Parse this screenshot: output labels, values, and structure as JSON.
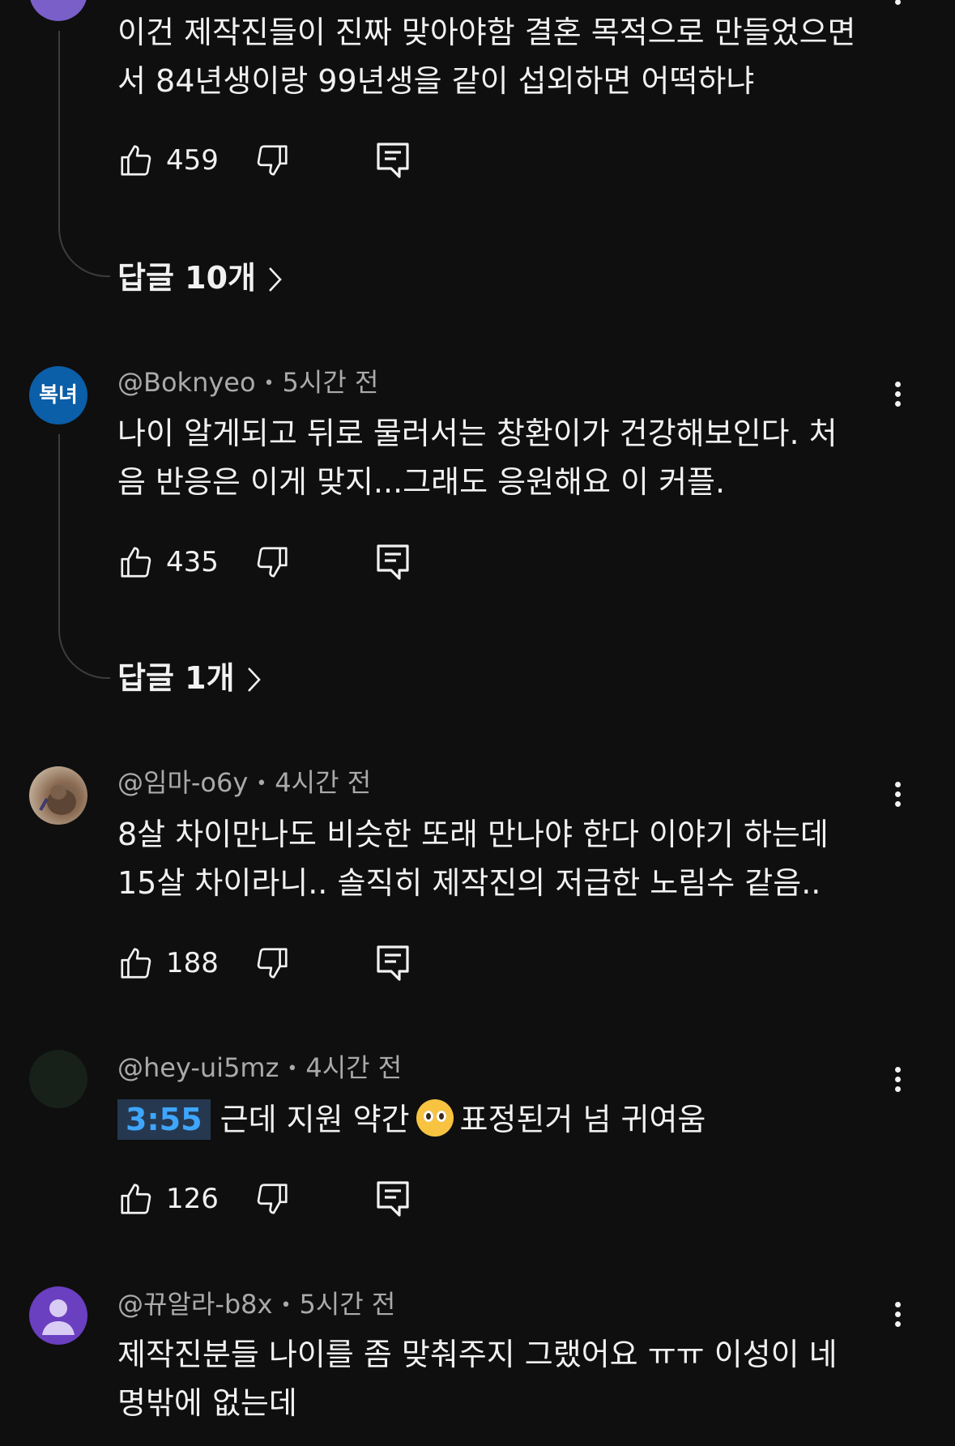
{
  "comments": [
    {
      "author": "",
      "time": "",
      "text_lines": [
        "이건 제작진들이 진짜 맞아야함 결혼 목적으로 만들었으면",
        "서 84년생이랑 99년생을 같이 섭외하면 어떡하냐"
      ],
      "likes": "459",
      "replies_label": "답글 10개",
      "avatar_color": "#7b5fc9"
    },
    {
      "author": "@Boknyeo",
      "time": "5시간 전",
      "avatar_text": "복녀",
      "avatar_color": "#0b5ea8",
      "text_lines": [
        "나이 알게되고 뒤로 물러서는 창환이가 건강해보인다. 처",
        "음 반응은 이게 맞지...그래도 응원해요 이 커플."
      ],
      "likes": "435",
      "replies_label": "답글 1개"
    },
    {
      "author": "@임마-o6y",
      "time": "4시간 전",
      "avatar_color": "#8a6a52",
      "text_lines": [
        "8살 차이만나도 비슷한 또래 만나야 한다 이야기 하는데",
        "15살 차이라니.. 솔직히 제작진의 저급한 노림수 같음.."
      ],
      "likes": "188"
    },
    {
      "author": "@hey-ui5mz",
      "time": "4시간 전",
      "avatar_color": "#17211a",
      "timestamp_link": "3:55",
      "text_parts": [
        "근데 지원 약간",
        "표정된거 넘 귀여움"
      ],
      "emoji_name": "pleading-face-emoji",
      "likes": "126"
    },
    {
      "author": "@뀨알라-b8x",
      "time": "5시간 전",
      "avatar_color": "#6a3fc0",
      "text_lines": [
        "제작진분들 나이를 좀 맞춰주지 그랬어요 ㅠㅠ 이성이 네",
        "명밖에 없는데"
      ]
    }
  ],
  "separator": "•",
  "colors": {
    "background": "#0f0f0f",
    "text": "#f1f1f1",
    "meta": "#aaaaaa",
    "timestamp_link": "#3ea6ff"
  }
}
